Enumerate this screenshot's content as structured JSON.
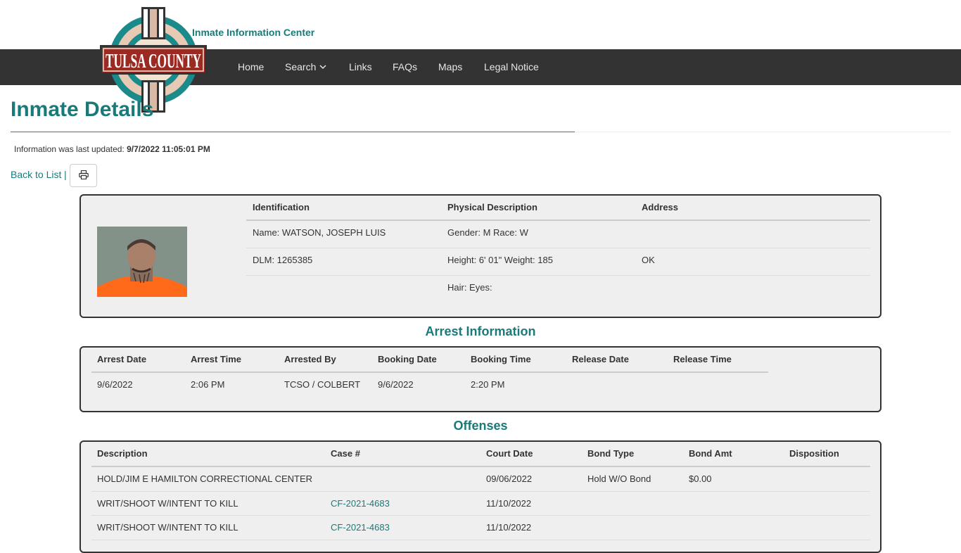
{
  "header": {
    "site_title": "Inmate Information Center",
    "logo_text": "TULSA COUNTY"
  },
  "nav": {
    "items": [
      {
        "label": "Home"
      },
      {
        "label": "Search"
      },
      {
        "label": "Links"
      },
      {
        "label": "FAQs"
      },
      {
        "label": "Maps"
      },
      {
        "label": "Legal Notice"
      }
    ]
  },
  "page": {
    "title": "Inmate Details",
    "updated_label": "Information was last updated:",
    "updated_value": "9/7/2022 11:05:01 PM",
    "back_label": "Back to List",
    "separator": "|"
  },
  "identity": {
    "headers": [
      "Identification",
      "Physical Description",
      "Address"
    ],
    "name": "Name: WATSON, JOSEPH LUIS",
    "dlm": "DLM: 1265385",
    "gender_race": "Gender: M Race: W",
    "height_weight": "Height: 6' 01\" Weight: 185",
    "hair_eyes": "Hair: Eyes:",
    "address_line1": "",
    "address_line2": "OK"
  },
  "arrest": {
    "title": "Arrest Information",
    "headers": [
      "Arrest Date",
      "Arrest Time",
      "Arrested By",
      "Booking Date",
      "Booking Time",
      "Release Date",
      "Release Time"
    ],
    "row": [
      "9/6/2022",
      "2:06 PM",
      "TCSO / COLBERT",
      "9/6/2022",
      "2:20 PM",
      "",
      ""
    ]
  },
  "offenses": {
    "title": "Offenses",
    "headers": [
      "Description",
      "Case #",
      "Court Date",
      "Bond Type",
      "Bond Amt",
      "Disposition"
    ],
    "rows": [
      [
        "HOLD/JIM E HAMILTON CORRECTIONAL CENTER",
        "",
        "09/06/2022",
        "Hold W/O Bond",
        "$0.00",
        ""
      ],
      [
        "WRIT/SHOOT W/INTENT TO KILL",
        "CF-2021-4683",
        "11/10/2022",
        "",
        "",
        ""
      ],
      [
        "WRIT/SHOOT W/INTENT TO KILL",
        "CF-2021-4683",
        "11/10/2022",
        "",
        "",
        ""
      ]
    ]
  },
  "colors": {
    "accent": "#1a7a7a",
    "navbar": "#333333",
    "rule": "#a0522d",
    "logo_red": "#9b2b22"
  }
}
